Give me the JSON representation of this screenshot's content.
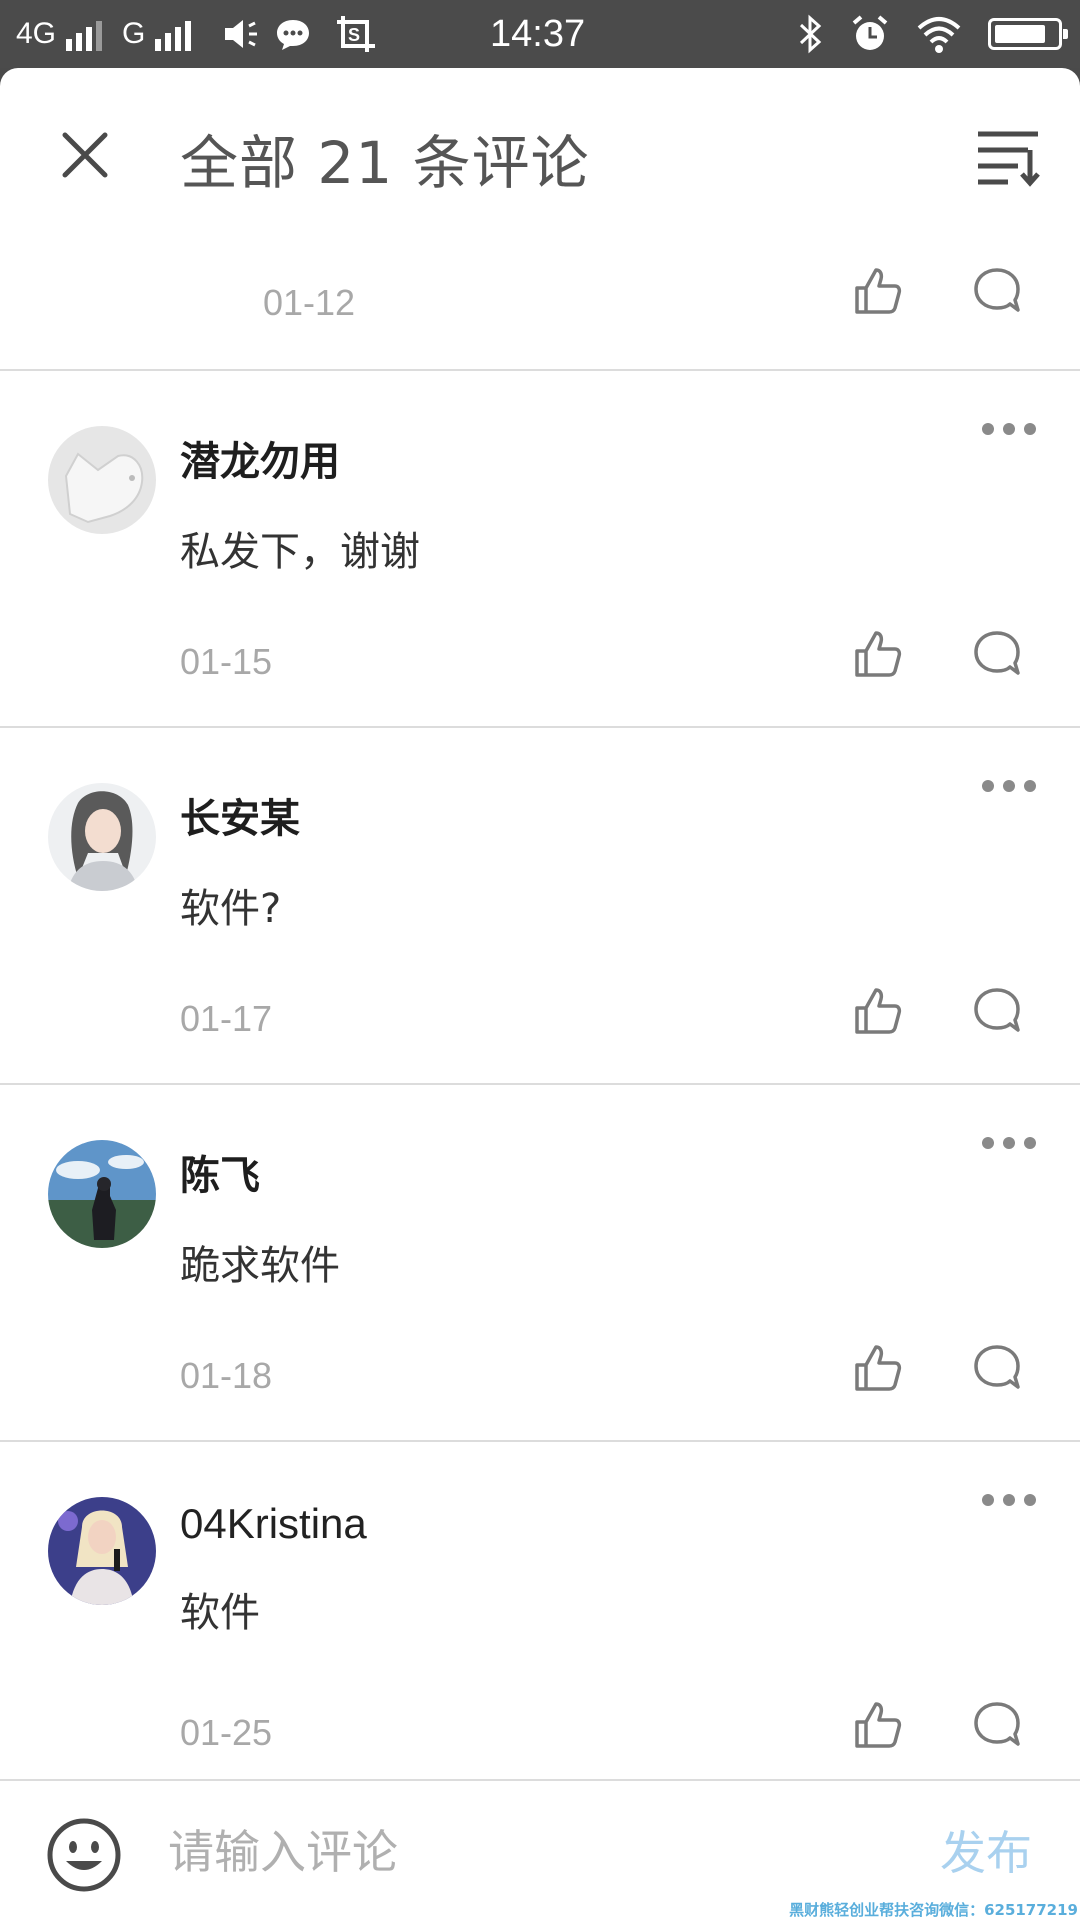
{
  "status_bar": {
    "network_1": "4G",
    "network_2": "G",
    "time": "14:37",
    "battery_level": 0.8
  },
  "header": {
    "title": "全部 21 条评论",
    "close_icon": "close-icon",
    "sort_icon": "sort-icon"
  },
  "first_item": {
    "date": "01-12"
  },
  "comments": [
    {
      "name": "潜龙勿用",
      "text": "私发下，谢谢",
      "date": "01-15"
    },
    {
      "name": "长安某",
      "text": "软件?",
      "date": "01-17"
    },
    {
      "name": "陈飞",
      "text": "跪求软件",
      "date": "01-18"
    },
    {
      "name": "04Kristina",
      "text": "软件",
      "date": "01-25"
    }
  ],
  "input_bar": {
    "placeholder": "请输入评论",
    "publish_label": "发布"
  },
  "watermark": "黑财熊轻创业帮扶咨询微信：625177219",
  "colors": {
    "status_bar_bg": "#4b4b4b",
    "divider": "#dcdcdc",
    "date_text": "#a8a8a8",
    "publish_disabled": "#a9d1ef"
  }
}
